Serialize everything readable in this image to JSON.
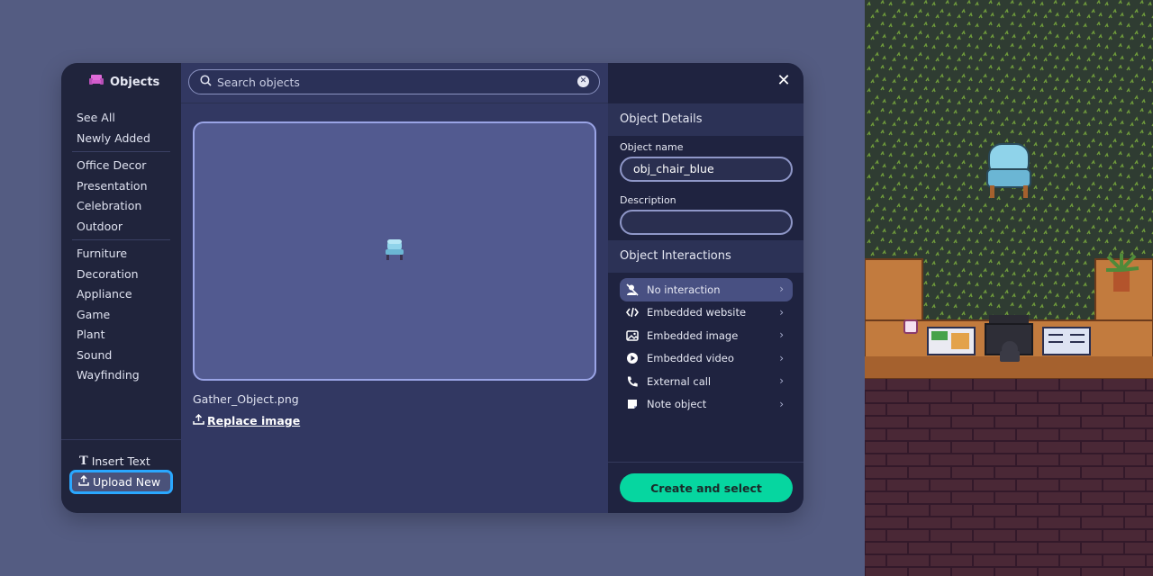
{
  "sidebar": {
    "title": "Objects",
    "groups": [
      [
        "See All",
        "Newly Added"
      ],
      [
        "Office Decor",
        "Presentation",
        "Celebration",
        "Outdoor"
      ],
      [
        "Furniture",
        "Decoration",
        "Appliance",
        "Game",
        "Plant",
        "Sound",
        "Wayfinding"
      ]
    ],
    "insert_text": "Insert Text",
    "upload_new": "Upload New"
  },
  "search": {
    "placeholder": "Search objects"
  },
  "preview": {
    "filename": "Gather_Object.png",
    "replace_label": "Replace image"
  },
  "details": {
    "header": "Object Details",
    "name_label": "Object name",
    "name_value": "obj_chair_blue",
    "description_label": "Description",
    "description_value": "",
    "interactions_header": "Object Interactions",
    "interactions": [
      {
        "label": "No interaction",
        "icon": "no-interaction-icon",
        "active": true
      },
      {
        "label": "Embedded website",
        "icon": "code-icon",
        "active": false
      },
      {
        "label": "Embedded image",
        "icon": "image-icon",
        "active": false
      },
      {
        "label": "Embedded video",
        "icon": "play-icon",
        "active": false
      },
      {
        "label": "External call",
        "icon": "phone-icon",
        "active": false
      },
      {
        "label": "Note object",
        "icon": "note-icon",
        "active": false
      }
    ],
    "create_button": "Create and select"
  },
  "colors": {
    "accent_green": "#06d6a0",
    "focus_blue": "#2aa7ff",
    "modal_bg": "#2a2f4f",
    "page_bg": "#545c82"
  }
}
